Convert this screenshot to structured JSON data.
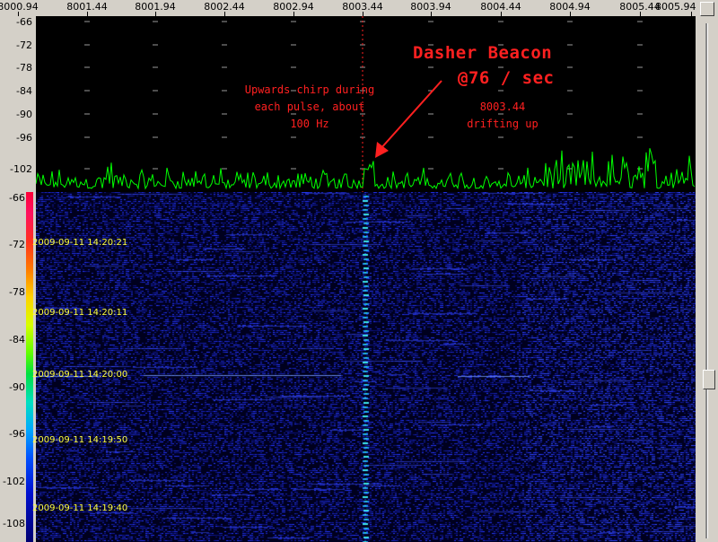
{
  "freq_axis": [
    "8000.94",
    "8001.44",
    "8001.94",
    "8002.44",
    "8002.94",
    "8003.44",
    "8003.94",
    "8004.44",
    "8004.94",
    "8005.44",
    "8005.94"
  ],
  "db_axis_spectrum": [
    "-66",
    "-72",
    "-78",
    "-84",
    "-90",
    "-96",
    "-102"
  ],
  "db_axis_waterfall": [
    "-66",
    "-72",
    "-78",
    "-84",
    "-90",
    "-96",
    "-102",
    "-108"
  ],
  "annotations": {
    "title_line1": "Dasher Beacon",
    "title_line2": "@76 / sec",
    "chirp_line1": "Upwards chirp during",
    "chirp_line2": "each pulse, about",
    "chirp_line3": "100 Hz",
    "freq_line1": "8003.44",
    "freq_line2": "drifting up"
  },
  "timestamps": [
    "2009-09-11 14:20:21",
    "2009-09-11 14:20:11",
    "2009-09-11 14:20:00",
    "2009-09-11 14:19:50",
    "2009-09-11 14:19:40"
  ],
  "colors": {
    "trace": "#00ff00",
    "annotation": "#ff2020",
    "timestamp": "#ffff40",
    "background": "#000000"
  }
}
